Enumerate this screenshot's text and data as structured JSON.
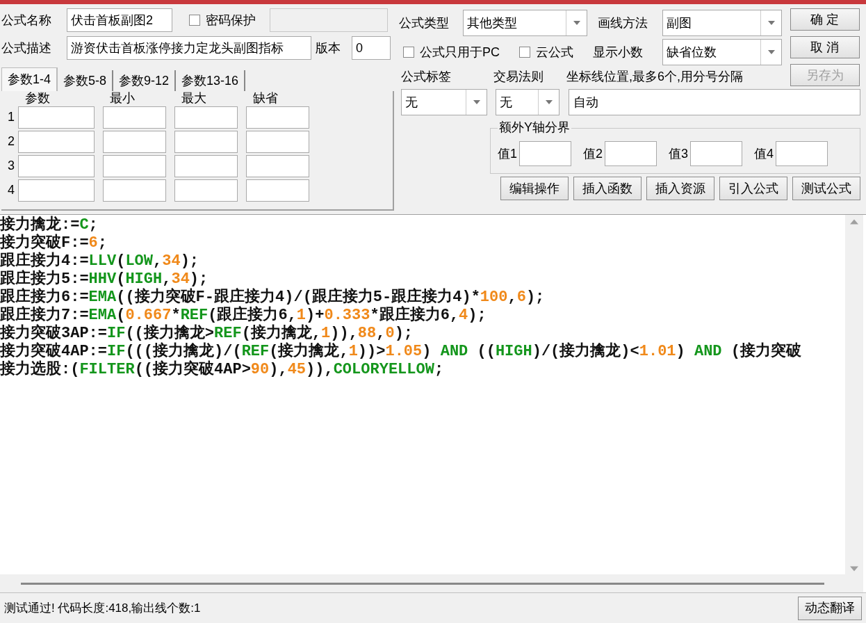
{
  "formula_name": {
    "label": "公式名称",
    "value": "伏击首板副图2"
  },
  "password": {
    "label": "密码保护",
    "checked": false
  },
  "description": {
    "label": "公式描述",
    "value": "游资伏击首板涨停接力定龙头副图指标"
  },
  "version": {
    "label": "版本",
    "value": "0"
  },
  "param_tabs": [
    {
      "label": "参数1-4",
      "selected": true
    },
    {
      "label": "参数5-8",
      "selected": false
    },
    {
      "label": "参数9-12",
      "selected": false
    },
    {
      "label": "参数13-16",
      "selected": false
    }
  ],
  "param_columns": [
    "参数",
    "最小",
    "最大",
    "缺省"
  ],
  "param_rows": [
    "1",
    "2",
    "3",
    "4"
  ],
  "formula_type": {
    "label": "公式类型",
    "value": "其他类型"
  },
  "draw_method": {
    "label": "画线方法",
    "value": "副图"
  },
  "pc_only": {
    "label": "公式只用于PC",
    "checked": false
  },
  "cloud": {
    "label": "云公式",
    "checked": false
  },
  "decimals": {
    "label": "显示小数",
    "value": "缺省位数"
  },
  "side_buttons": [
    {
      "label": "确 定",
      "disabled": false
    },
    {
      "label": "取 消",
      "disabled": false
    },
    {
      "label": "另存为",
      "disabled": true
    }
  ],
  "formula_tag": {
    "label": "公式标签",
    "value": "无"
  },
  "trade_rule": {
    "label": "交易法则",
    "value": "无"
  },
  "axis_lines": {
    "label": "坐标线位置,最多6个,用分号分隔",
    "value": "自动"
  },
  "y_axis_group": {
    "title": "额外Y轴分界",
    "fields": [
      "值1",
      "值2",
      "值3",
      "值4"
    ]
  },
  "action_buttons": [
    "编辑操作",
    "插入函数",
    "插入资源",
    "引入公式",
    "测试公式"
  ],
  "code_lines": [
    [
      {
        "kind": "plain",
        "text": "接力擒龙:="
      },
      {
        "kind": "fn",
        "text": "C"
      },
      {
        "kind": "plain",
        "text": ";"
      }
    ],
    [
      {
        "kind": "plain",
        "text": "接力突破F:="
      },
      {
        "kind": "num",
        "text": "6"
      },
      {
        "kind": "plain",
        "text": ";"
      }
    ],
    [
      {
        "kind": "plain",
        "text": "跟庄接力4:="
      },
      {
        "kind": "fn",
        "text": "LLV"
      },
      {
        "kind": "plain",
        "text": "("
      },
      {
        "kind": "fn",
        "text": "LOW"
      },
      {
        "kind": "plain",
        "text": ","
      },
      {
        "kind": "num",
        "text": "34"
      },
      {
        "kind": "plain",
        "text": ");"
      }
    ],
    [
      {
        "kind": "plain",
        "text": "跟庄接力5:="
      },
      {
        "kind": "fn",
        "text": "HHV"
      },
      {
        "kind": "plain",
        "text": "("
      },
      {
        "kind": "fn",
        "text": "HIGH"
      },
      {
        "kind": "plain",
        "text": ","
      },
      {
        "kind": "num",
        "text": "34"
      },
      {
        "kind": "plain",
        "text": ");"
      }
    ],
    [
      {
        "kind": "plain",
        "text": "跟庄接力6:="
      },
      {
        "kind": "fn",
        "text": "EMA"
      },
      {
        "kind": "plain",
        "text": "((接力突破F-跟庄接力4)/(跟庄接力5-跟庄接力4)*"
      },
      {
        "kind": "num",
        "text": "100"
      },
      {
        "kind": "plain",
        "text": ","
      },
      {
        "kind": "num",
        "text": "6"
      },
      {
        "kind": "plain",
        "text": ");"
      }
    ],
    [
      {
        "kind": "plain",
        "text": "跟庄接力7:="
      },
      {
        "kind": "fn",
        "text": "EMA"
      },
      {
        "kind": "plain",
        "text": "("
      },
      {
        "kind": "num",
        "text": "0.667"
      },
      {
        "kind": "plain",
        "text": "*"
      },
      {
        "kind": "fn",
        "text": "REF"
      },
      {
        "kind": "plain",
        "text": "(跟庄接力6,"
      },
      {
        "kind": "num",
        "text": "1"
      },
      {
        "kind": "plain",
        "text": ")+"
      },
      {
        "kind": "num",
        "text": "0.333"
      },
      {
        "kind": "plain",
        "text": "*跟庄接力6,"
      },
      {
        "kind": "num",
        "text": "4"
      },
      {
        "kind": "plain",
        "text": ");"
      }
    ],
    [
      {
        "kind": "plain",
        "text": "接力突破3AP:="
      },
      {
        "kind": "fn",
        "text": "IF"
      },
      {
        "kind": "plain",
        "text": "((接力擒龙>"
      },
      {
        "kind": "fn",
        "text": "REF"
      },
      {
        "kind": "plain",
        "text": "(接力擒龙,"
      },
      {
        "kind": "num",
        "text": "1"
      },
      {
        "kind": "plain",
        "text": ")),"
      },
      {
        "kind": "num",
        "text": "88"
      },
      {
        "kind": "plain",
        "text": ","
      },
      {
        "kind": "num",
        "text": "0"
      },
      {
        "kind": "plain",
        "text": ");"
      }
    ],
    [
      {
        "kind": "plain",
        "text": "接力突破4AP:="
      },
      {
        "kind": "fn",
        "text": "IF"
      },
      {
        "kind": "plain",
        "text": "(((接力擒龙)/("
      },
      {
        "kind": "fn",
        "text": "REF"
      },
      {
        "kind": "plain",
        "text": "(接力擒龙,"
      },
      {
        "kind": "num",
        "text": "1"
      },
      {
        "kind": "plain",
        "text": "))>"
      },
      {
        "kind": "num",
        "text": "1.05"
      },
      {
        "kind": "plain",
        "text": ") "
      },
      {
        "kind": "fn",
        "text": "AND"
      },
      {
        "kind": "plain",
        "text": " (("
      },
      {
        "kind": "fn",
        "text": "HIGH"
      },
      {
        "kind": "plain",
        "text": ")/(接力擒龙)<"
      },
      {
        "kind": "num",
        "text": "1.01"
      },
      {
        "kind": "plain",
        "text": ") "
      },
      {
        "kind": "fn",
        "text": "AND"
      },
      {
        "kind": "plain",
        "text": " (接力突破"
      }
    ],
    [
      {
        "kind": "plain",
        "text": "接力选股:("
      },
      {
        "kind": "fn",
        "text": "FILTER"
      },
      {
        "kind": "plain",
        "text": "((接力突破4AP>"
      },
      {
        "kind": "num",
        "text": "90"
      },
      {
        "kind": "plain",
        "text": "),"
      },
      {
        "kind": "num",
        "text": "45"
      },
      {
        "kind": "plain",
        "text": ")),"
      },
      {
        "kind": "fn",
        "text": "COLORYELLOW"
      },
      {
        "kind": "plain",
        "text": ";"
      }
    ]
  ],
  "status": "测试通过! 代码长度:418,输出线个数:1",
  "translate_button": "动态翻译"
}
